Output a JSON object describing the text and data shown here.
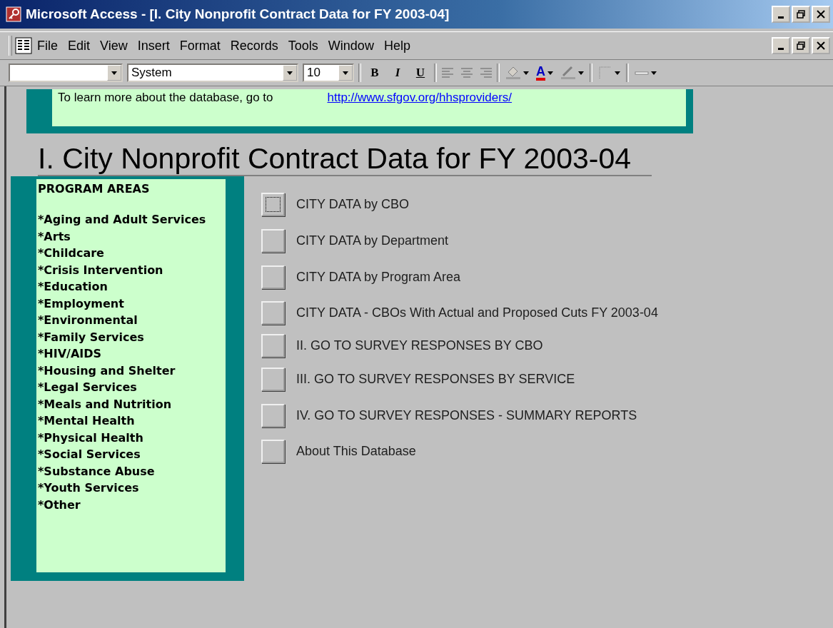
{
  "window": {
    "title": "Microsoft Access - [I. City Nonprofit Contract Data for FY 2003-04]"
  },
  "menu": [
    "File",
    "Edit",
    "View",
    "Insert",
    "Format",
    "Records",
    "Tools",
    "Window",
    "Help"
  ],
  "toolbar": {
    "font": "System",
    "size": "10",
    "styles": [
      {
        "label": "B",
        "kind": "bold"
      },
      {
        "label": "I",
        "kind": "italic"
      },
      {
        "label": "U",
        "kind": "underline"
      }
    ],
    "font_color_label": "A"
  },
  "banner": {
    "text": "To learn more about the database, go to",
    "link": "http://www.sfgov.org/hhsproviders/"
  },
  "heading": "I. City Nonprofit Contract Data for FY 2003-04",
  "program_areas": {
    "title": "PROGRAM AREAS",
    "items": [
      "*Aging and Adult Services",
      "*Arts",
      "*Childcare",
      "*Crisis Intervention",
      "*Education",
      "*Employment",
      "*Environmental",
      "*Family Services",
      "*HIV/AIDS",
      "*Housing and Shelter",
      "*Legal Services",
      "*Meals and Nutrition",
      "*Mental Health",
      "*Physical Health",
      "*Social Services",
      "*Substance Abuse",
      "*Youth Services",
      "*Other"
    ]
  },
  "commands": [
    {
      "label": "CITY DATA by CBO",
      "focused": true
    },
    {
      "label": "CITY DATA by Department",
      "focused": false
    },
    {
      "label": "CITY DATA by Program Area",
      "focused": false
    },
    {
      "label": "CITY DATA - CBOs With Actual and Proposed Cuts FY 2003-04",
      "focused": false
    },
    {
      "label": "II. GO TO SURVEY RESPONSES BY CBO",
      "focused": false
    },
    {
      "label": "III. GO TO SURVEY RESPONSES BY SERVICE",
      "focused": false
    },
    {
      "label": "IV. GO TO SURVEY RESPONSES - SUMMARY REPORTS",
      "focused": false
    },
    {
      "label": "About This Database",
      "focused": false
    }
  ]
}
